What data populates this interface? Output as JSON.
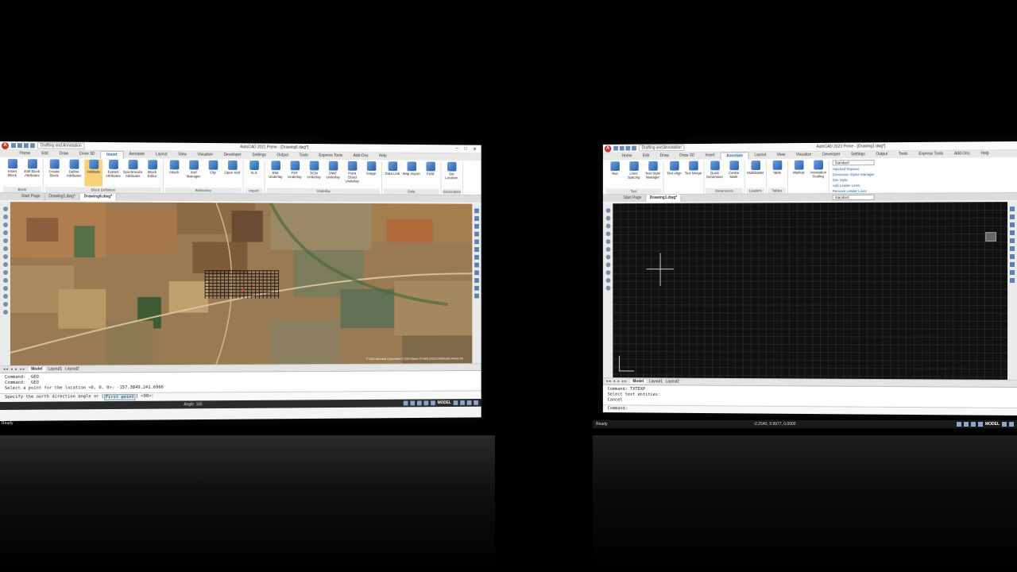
{
  "left": {
    "title": "AutoCAD 2021 Prime - [Drawing6.dwg*]",
    "workspace": "Drafting and Annotation",
    "tabs": [
      "Home",
      "Edit",
      "Draw",
      "Draw 3D",
      "Insert",
      "Annotate",
      "Layout",
      "View",
      "Visualize",
      "Developer",
      "Settings",
      "Output",
      "Tools",
      "Express Tools",
      "Add-Ons",
      "Help"
    ],
    "active_tab": "Insert",
    "ribbon_groups": [
      {
        "title": "Block",
        "buttons": [
          "Insert Block",
          "Edit Block Attributes"
        ]
      },
      {
        "title": "Block Definition",
        "buttons": [
          "Create Block",
          "Define Attributes",
          "Attribute",
          "Extract Attributes",
          "Synchronize Attributes",
          "Block Editor"
        ]
      },
      {
        "title": "Reference",
        "buttons": [
          "Attach",
          "Xref Manager",
          "Clip",
          "Open Xref"
        ]
      },
      {
        "title": "Import",
        "buttons": [
          "XLS"
        ]
      },
      {
        "title": "Underlay",
        "buttons": [
          "BIM Underlay",
          "PDF Underlay",
          "DGN Underlay",
          "DWF Underlay",
          "Point Cloud Underlay",
          "Image"
        ]
      },
      {
        "title": "Data",
        "buttons": [
          "Data Link",
          "Map Import",
          "Field"
        ]
      },
      {
        "title": "Geolocation",
        "buttons": [
          "Set Location"
        ]
      }
    ],
    "doc_tabs": [
      "Start Page",
      "Drawing1.dwg*",
      "Drawing6.dwg*"
    ],
    "active_doc": "Drawing6.dwg*",
    "map_credit": "© 2022 Microsoft Corporation © 2022 Maxar ©CNES (2022) Distribution Airbus DS",
    "layout_tabs": [
      "Model",
      "Layout1",
      "Layout2"
    ],
    "command_history": [
      "Command: _GEO",
      "Command: _GEO",
      "Select a point for the location <0, 0, 0>: -157.3849,241.6966"
    ],
    "command_prompt": "Specify the north direction angle or",
    "command_option": "First point",
    "command_suffix": "<90>:",
    "status_angle": "Angle: 165",
    "status_model": "MODEL",
    "status_ready": "Ready"
  },
  "right": {
    "title": "AutoCAD 2023 Prime - [Drawing1.dwg*]",
    "workspace": "Drafting and Annotation",
    "tabs": [
      "Home",
      "Edit",
      "Draw",
      "Draw 3D",
      "Insert",
      "Annotate",
      "Layout",
      "View",
      "Visualize",
      "Developer",
      "Settings",
      "Output",
      "Tools",
      "Express Tools",
      "Add-Ons",
      "Help"
    ],
    "active_tab": "Annotate",
    "text_style": "Standard",
    "dim_style": "Standard",
    "ribbon_groups": [
      {
        "title": "Text",
        "buttons": [
          "Text",
          "Lines Spacing",
          "Text Style Manager"
        ]
      },
      {
        "title": "",
        "buttons": [
          "Text Align",
          "Text Merge"
        ]
      },
      {
        "title": "Dimensions",
        "buttons": [
          "Quick Dimension",
          "Centre Mark"
        ]
      },
      {
        "title": "Leaders",
        "buttons": [
          "Multileader"
        ]
      },
      {
        "title": "Tables",
        "buttons": [
          "Table"
        ]
      },
      {
        "title": "",
        "buttons": [
          "Markup",
          "Annotation Scaling"
        ]
      }
    ],
    "ribbon_links": [
      "Hatched Replace",
      "Dimension Styles Manager",
      "Dim Style",
      "Add Leader Lines",
      "Remove Leader Lines"
    ],
    "doc_tabs": [
      "Start Page",
      "Drawing1.dwg*"
    ],
    "active_doc": "Drawing1.dwg*",
    "layout_tabs": [
      "Model",
      "Layout1",
      "Layout2"
    ],
    "command_history": [
      "Command: TXTEXP",
      "Select text entities:",
      "Cancel"
    ],
    "command_prompt": "Command:",
    "status_coords": "-2.2540, 9.9977, 0.0000",
    "status_model": "MODEL",
    "status_ready": "Ready"
  }
}
